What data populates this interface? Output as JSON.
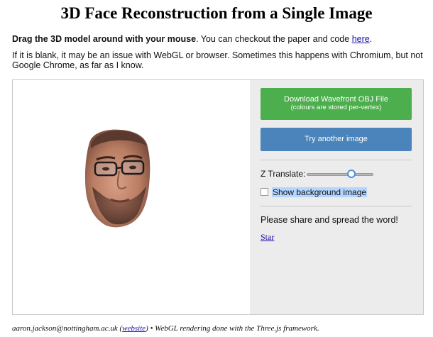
{
  "title": "3D Face Reconstruction from a Single Image",
  "intro": {
    "bold": "Drag the 3D model around with your mouse",
    "text": ". You can checkout the paper and code ",
    "link": "here",
    "end": "."
  },
  "note": "If it is blank, it may be an issue with WebGL or browser. Sometimes this happens with Chromium, but not Google Chrome, as far as I know.",
  "sidebar": {
    "download_label": "Download Wavefront OBJ File",
    "download_sub": "(colours are stored per-vertex)",
    "try_label": "Try another image",
    "ztranslate_label": "Z Translate:",
    "ztranslate_fraction": 0.7,
    "bg_label": "Show background image",
    "bg_checked": false,
    "share_text": "Please share and spread the word!",
    "star_label": "Star"
  },
  "footer": {
    "email": "aaron.jackson@nottingham.ac.uk",
    "link": "website",
    "rest": " • WebGL rendering done with the Three.js framework."
  },
  "colors": {
    "download_button": "#4cae4c",
    "try_button": "#4a84ba",
    "sidebar_bg": "#ececec",
    "selection_highlight": "#b4d5fe"
  }
}
